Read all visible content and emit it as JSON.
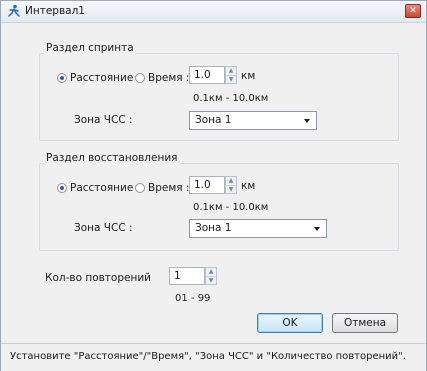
{
  "window": {
    "title": "Интервал1",
    "close_label": "✕"
  },
  "sprint": {
    "group_title": "Раздел спринта",
    "distance_label": "Расстояние",
    "time_label": "Время :",
    "selected_mode": "distance",
    "value": "1.0",
    "unit": "км",
    "range": "0.1км - 10.0км",
    "hr_zone_label": "Зона ЧСС :",
    "hr_zone_value": "Зона 1"
  },
  "recovery": {
    "group_title": "Раздел восстановления",
    "distance_label": "Расстояние",
    "time_label": "Время :",
    "selected_mode": "distance",
    "value": "1.0",
    "unit": "км",
    "range": "0.1км - 10.0км",
    "hr_zone_label": "Зона ЧСС :",
    "hr_zone_value": "Зона 1"
  },
  "repeats": {
    "label": "Кол-во повторений",
    "value": "1",
    "range": "01 - 99"
  },
  "buttons": {
    "ok": "OK",
    "cancel": "Отмена"
  },
  "status": {
    "text": "Установите \"Расстояние\"/\"Время\", \"Зона ЧСС\" и \"Количество повторений\"."
  },
  "icons": {
    "app": "runner-icon",
    "spin_up": "▲",
    "spin_down": "▼"
  }
}
